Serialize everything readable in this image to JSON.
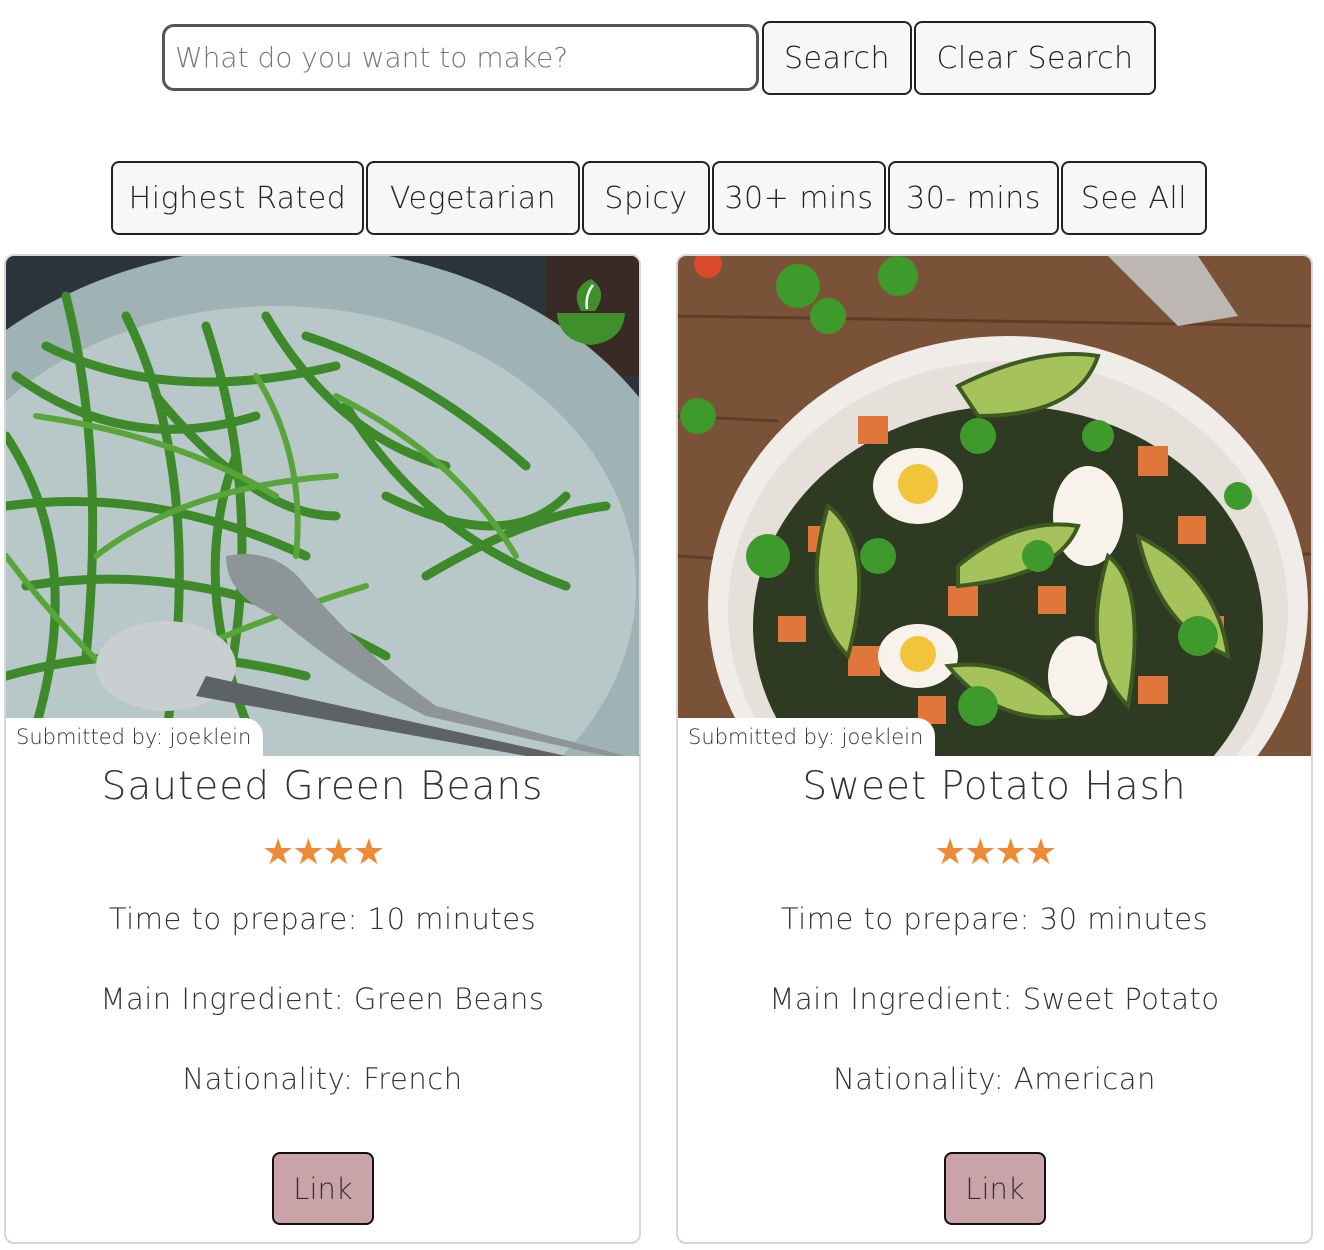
{
  "search": {
    "placeholder": "What do you want to make?",
    "value": "",
    "search_label": "Search",
    "clear_label": "Clear Search"
  },
  "filters": [
    {
      "label": "Highest Rated"
    },
    {
      "label": "Vegetarian"
    },
    {
      "label": "Spicy"
    },
    {
      "label": "30+ mins"
    },
    {
      "label": "30- mins"
    },
    {
      "label": "See All"
    }
  ],
  "accent_colors": {
    "star": "#ee8a35",
    "link_button": "#c9a3a7",
    "vegetarian_badge": "#3f8f2d"
  },
  "recipes": [
    {
      "submitted_by": "Submitted by: joeklein",
      "title": "Sauteed Green Beans",
      "rating": 4,
      "stars": "★★★★",
      "time": "Time to prepare: 10 minutes",
      "ingredient": "Main Ingredient: Green Beans",
      "nationality": "Nationality: French",
      "link_label": "Link",
      "badge_icon": "vegetarian-bowl-icon"
    },
    {
      "submitted_by": "Submitted by: joeklein",
      "title": "Sweet Potato Hash",
      "rating": 4,
      "stars": "★★★★",
      "time": "Time to prepare: 30 minutes",
      "ingredient": "Main Ingredient: Sweet Potato",
      "nationality": "Nationality: American",
      "link_label": "Link"
    }
  ]
}
